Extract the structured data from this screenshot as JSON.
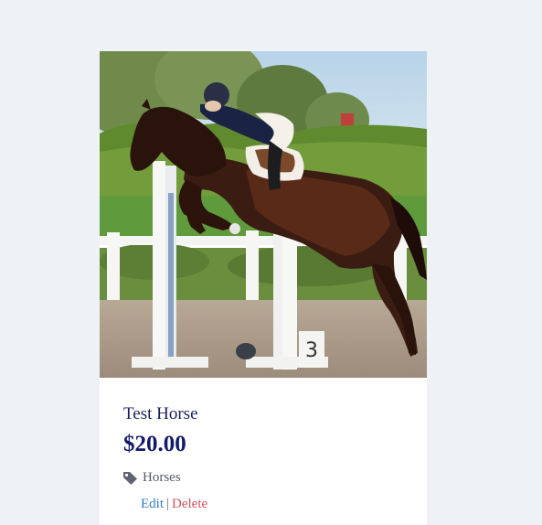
{
  "listing": {
    "photo_alt": "Horse jumping over a white fence",
    "title": "Test Horse",
    "price": "$20.00",
    "category_icon": "tag-icon",
    "category": "Horses",
    "actions": {
      "edit_label": "Edit",
      "separator": "|",
      "delete_label": "Delete"
    }
  },
  "colors": {
    "page_background": "#eef2f7",
    "card_background": "#ffffff",
    "title": "#1a1f5e",
    "price": "#12186b",
    "edit_link": "#2f7cc4",
    "delete_link": "#d24d57"
  }
}
